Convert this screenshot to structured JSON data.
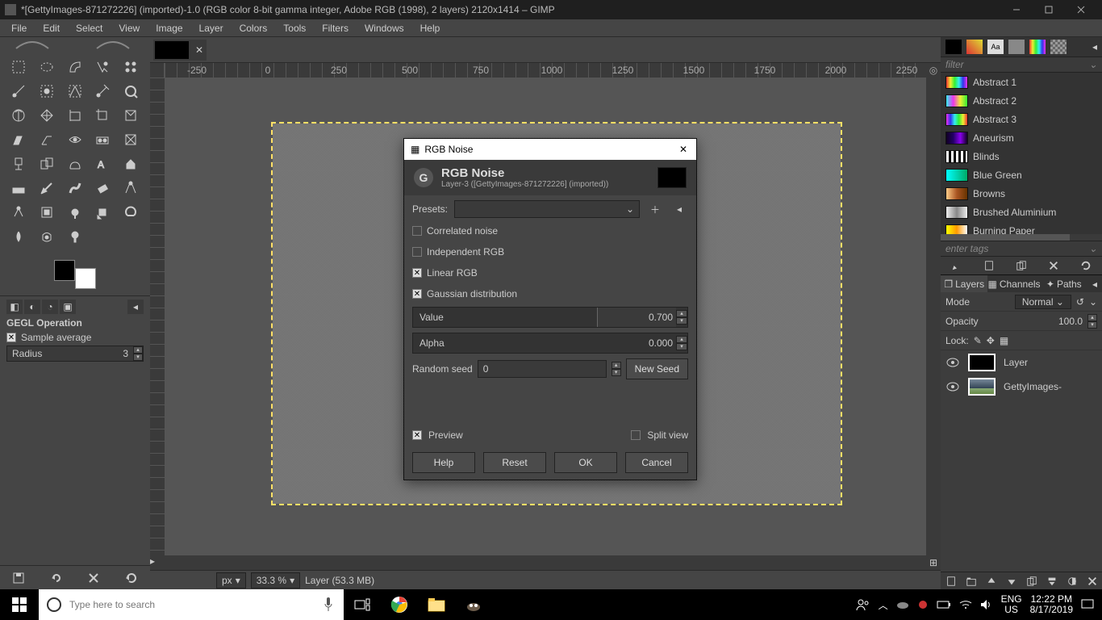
{
  "titlebar": {
    "text": "*[GettyImages-871272226] (imported)-1.0 (RGB color 8-bit gamma integer, Adobe RGB (1998), 2 layers) 2120x1414 – GIMP"
  },
  "menubar": [
    "File",
    "Edit",
    "Select",
    "View",
    "Image",
    "Layer",
    "Colors",
    "Tools",
    "Filters",
    "Windows",
    "Help"
  ],
  "tool_options": {
    "title": "GEGL Operation",
    "sample_average": "Sample average",
    "radius_label": "Radius",
    "radius_value": "3"
  },
  "ruler_labels": [
    "-250",
    "0",
    "250",
    "500",
    "750",
    "1000",
    "1250",
    "1500",
    "1750",
    "2000",
    "2250"
  ],
  "status": {
    "unit": "px",
    "zoom": "33.3 %",
    "layer_info": "Layer (53.3 MB)"
  },
  "dialog": {
    "wintitle": "RGB Noise",
    "title": "RGB Noise",
    "subtitle": "Layer-3 ([GettyImages-871272226] (imported))",
    "presets": "Presets:",
    "correlated": "Correlated noise",
    "independent": "Independent RGB",
    "linear": "Linear RGB",
    "gaussian": "Gaussian distribution",
    "value_label": "Value",
    "value": "0.700",
    "alpha_label": "Alpha",
    "alpha": "0.000",
    "seed_label": "Random seed",
    "seed": "0",
    "newseed": "New Seed",
    "preview": "Preview",
    "split": "Split view",
    "help": "Help",
    "reset": "Reset",
    "ok": "OK",
    "cancel": "Cancel"
  },
  "right": {
    "filter_placeholder": "filter",
    "gradients": [
      "Abstract 1",
      "Abstract 2",
      "Abstract 3",
      "Aneurism",
      "Blinds",
      "Blue Green",
      "Browns",
      "Brushed Aluminium",
      "Burning Paper"
    ],
    "enter_tags": "enter tags",
    "panel_tabs": {
      "layers": "Layers",
      "channels": "Channels",
      "paths": "Paths"
    },
    "mode_label": "Mode",
    "mode": "Normal",
    "opacity_label": "Opacity",
    "opacity": "100.0",
    "lock_label": "Lock:",
    "layers": [
      {
        "name": "Layer"
      },
      {
        "name": "GettyImages-"
      }
    ]
  },
  "taskbar": {
    "search_placeholder": "Type here to search",
    "lang1": "ENG",
    "lang2": "US",
    "time": "12:22 PM",
    "date": "8/17/2019"
  },
  "gradient_styles": [
    "linear-gradient(to right,#e33,#ee3,#3e3,#3ee,#33e,#e3e)",
    "linear-gradient(to right,#3ee,#e3e,#ee3,#3e3)",
    "linear-gradient(to right,#e3e,#33e,#3ee,#3e3,#ee3,#e33)",
    "linear-gradient(to right,#102,#206,#80e,#102)",
    "repeating-linear-gradient(to right,#fff 0 3px,#000 3px 6px)",
    "linear-gradient(to right,#0ff,#0a6)",
    "linear-gradient(to right,#fc8,#a52,#630)",
    "linear-gradient(to right,#eee,#888,#eee)",
    "linear-gradient(to right,#ff0,#f90,#fff)"
  ]
}
